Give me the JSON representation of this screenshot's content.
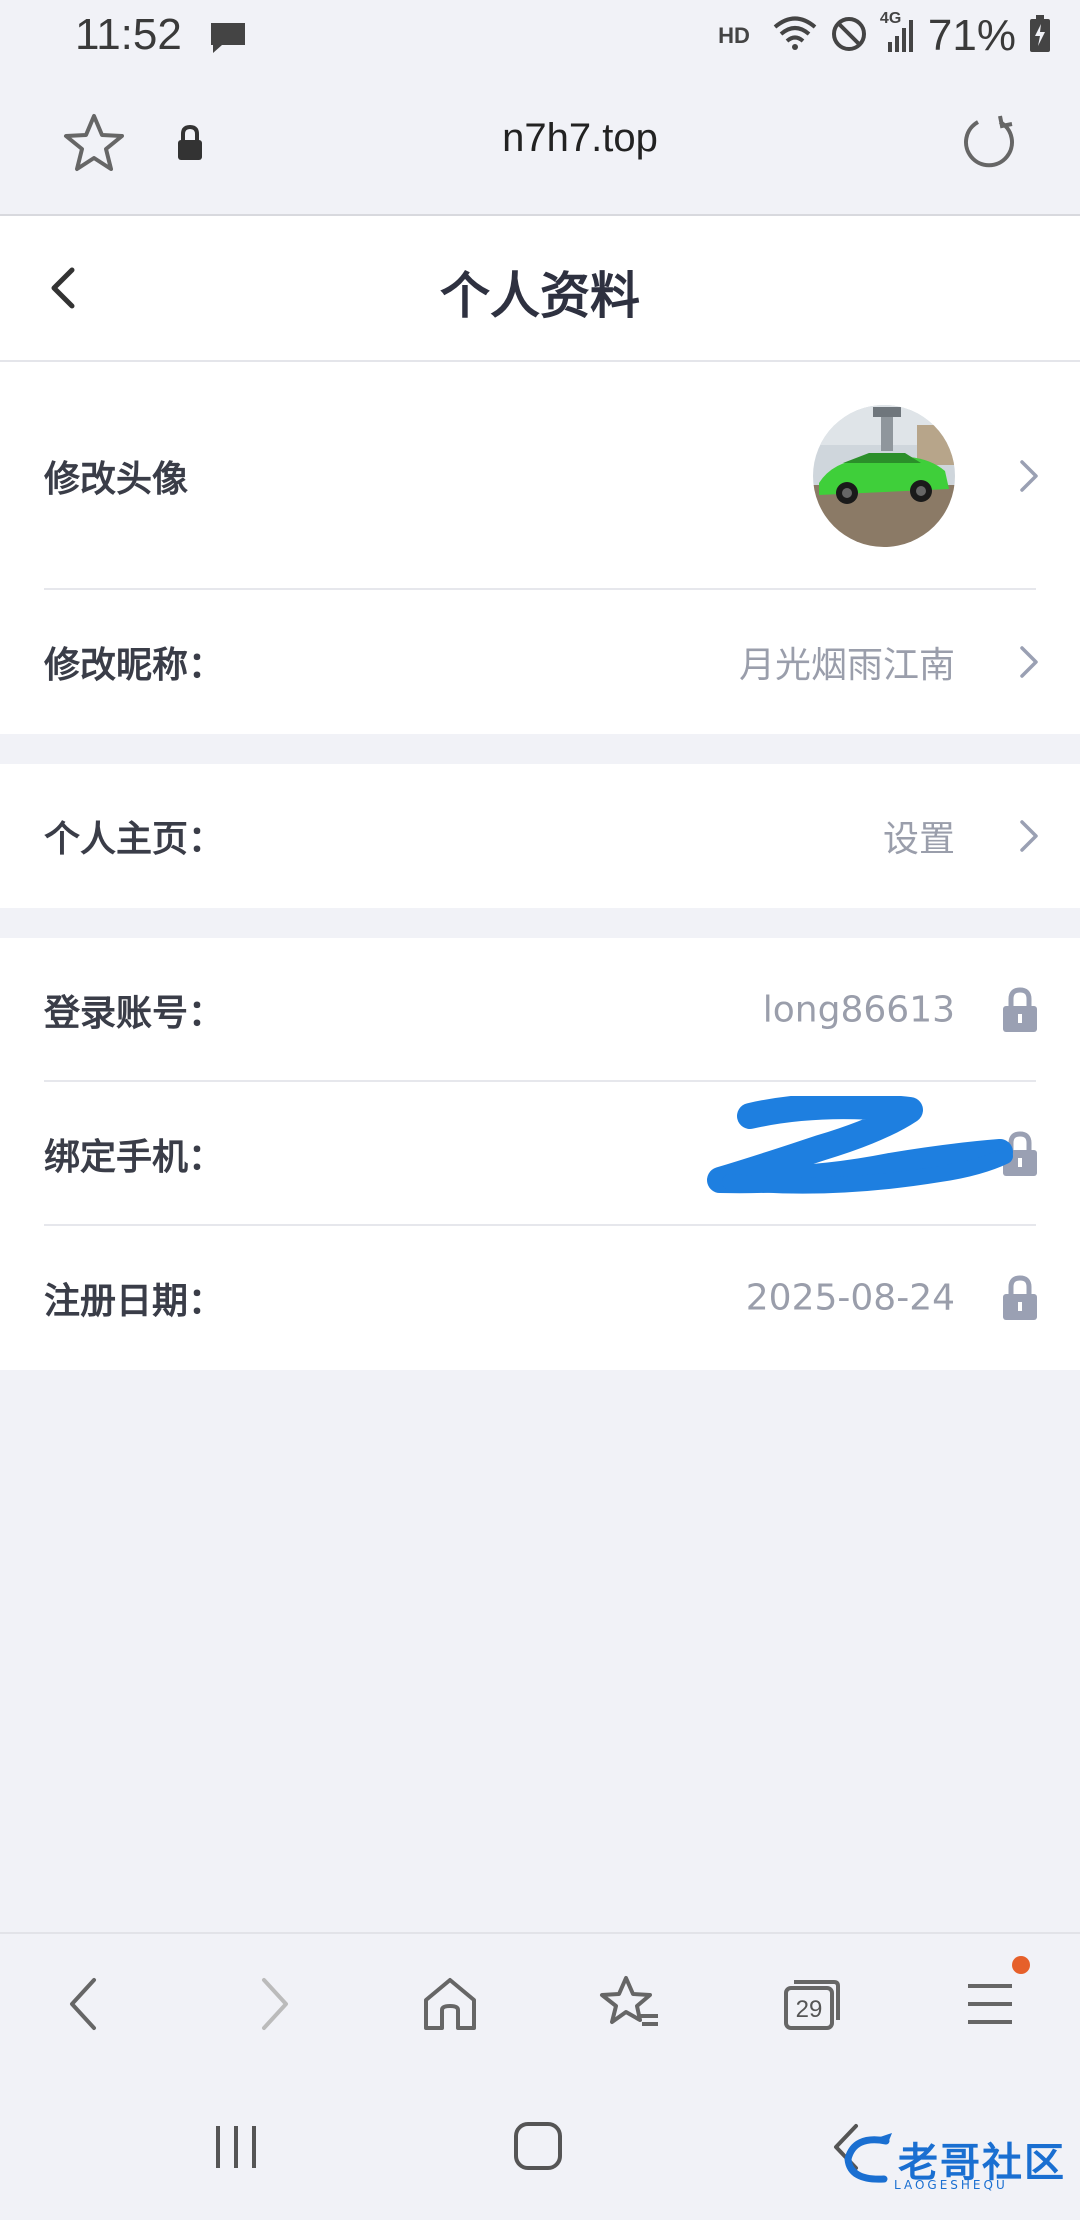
{
  "status_bar": {
    "time": "11:52",
    "hd_label": "HD",
    "network": "4G",
    "battery": "71%",
    "icons": [
      "message-icon",
      "wifi-icon",
      "do-not-disturb-icon",
      "signal-icon",
      "battery-charging-icon"
    ]
  },
  "browser": {
    "domain": "n7h7.top",
    "tab_count": "29"
  },
  "header": {
    "title": "个人资料"
  },
  "profile": {
    "avatar_label": "修改头像",
    "nickname_label": "修改昵称：",
    "nickname_value": "月光烟雨江南",
    "homepage_label": "个人主页：",
    "homepage_value": "设置",
    "account_label": "登录账号：",
    "account_value": "long86613",
    "phone_label": "绑定手机：",
    "register_label": "注册日期：",
    "register_value": "2025-08-24"
  },
  "watermark": {
    "text": "老哥社区",
    "sub": "LAOGESHEQU"
  },
  "colors": {
    "background": "#f1f2f7",
    "label": "#3a3d48",
    "value": "#9a9eab",
    "lock": "#9aa0b3",
    "scribble": "#1e7fe0",
    "badge": "#e6602a",
    "watermark": "#1a6fd1"
  }
}
